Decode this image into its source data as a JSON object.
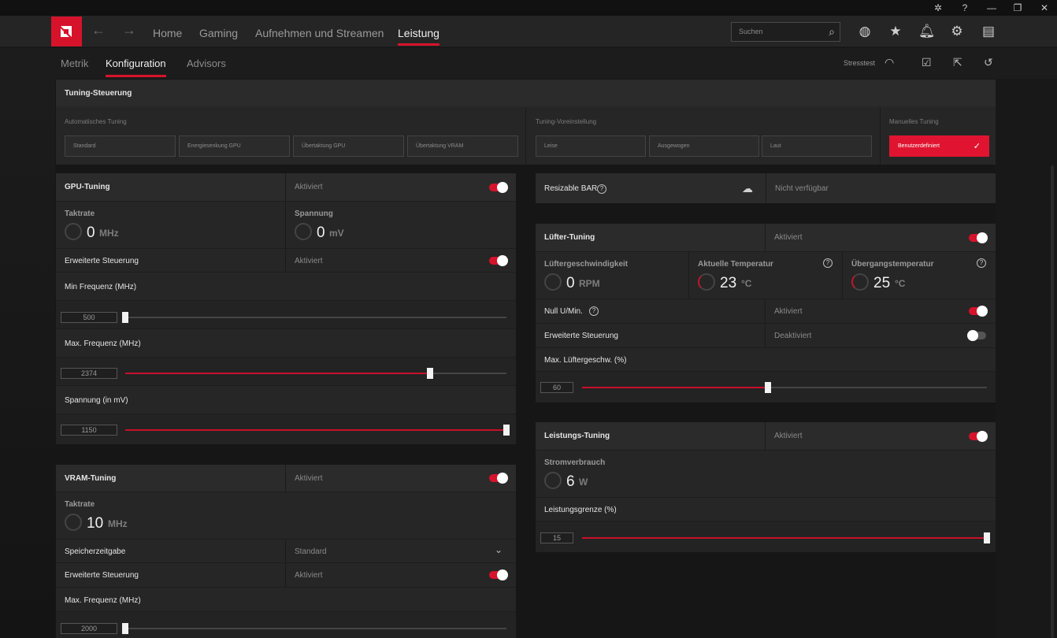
{
  "nav": {
    "items": [
      "Home",
      "Gaming",
      "Aufnehmen und Streamen",
      "Leistung"
    ],
    "search_placeholder": "Suchen"
  },
  "subnav": {
    "items": [
      "Metrik",
      "Konfiguration",
      "Advisors"
    ],
    "stresstest": "Stresstest"
  },
  "tuning": {
    "title": "Tuning-Steuerung",
    "auto_label": "Automatisches Tuning",
    "auto_buttons": [
      "Standard",
      "Energiesenkung GPU",
      "Übertaktung GPU",
      "Übertaktung VRAM"
    ],
    "preset_label": "Tuning-Voreinstellung",
    "preset_buttons": [
      "Leise",
      "Ausgewogen",
      "Laut"
    ],
    "manual_label": "Manuelles Tuning",
    "manual_button": "Benutzerdefiniert"
  },
  "gpu": {
    "title": "GPU-Tuning",
    "state": "Aktiviert",
    "clock_label": "Taktrate",
    "clock_value": "0",
    "clock_unit": "MHz",
    "voltage_label": "Spannung",
    "voltage_value": "0",
    "voltage_unit": "mV",
    "adv_label": "Erweiterte Steuerung",
    "adv_state": "Aktiviert",
    "min_freq_label": "Min Frequenz (MHz)",
    "min_freq_value": "500",
    "max_freq_label": "Max. Frequenz (MHz)",
    "max_freq_value": "2374",
    "volt_label": "Spannung (in mV)",
    "volt_value": "1150"
  },
  "vram": {
    "title": "VRAM-Tuning",
    "state": "Aktiviert",
    "clock_label": "Taktrate",
    "clock_value": "10",
    "clock_unit": "MHz",
    "timing_label": "Speicherzeitgabe",
    "timing_value": "Standard",
    "adv_label": "Erweiterte Steuerung",
    "adv_state": "Aktiviert",
    "max_freq_label": "Max. Frequenz (MHz)",
    "max_freq_value": "2000"
  },
  "bar": {
    "label": "Resizable BAR",
    "state": "Nicht verfügbar"
  },
  "fan": {
    "title": "Lüfter-Tuning",
    "state": "Aktiviert",
    "speed_label": "Lüftergeschwindigkeit",
    "speed_value": "0",
    "speed_unit": "RPM",
    "temp_label": "Aktuelle Temperatur",
    "temp_value": "23",
    "temp_unit": "°C",
    "junction_label": "Übergangstemperatur",
    "junction_value": "25",
    "junction_unit": "°C",
    "zero_label": "Null U/Min.",
    "zero_state": "Aktiviert",
    "adv_label": "Erweiterte Steuerung",
    "adv_state": "Deaktiviert",
    "max_label": "Max. Lüftergeschw. (%)",
    "max_value": "60"
  },
  "power": {
    "title": "Leistungs-Tuning",
    "state": "Aktiviert",
    "usage_label": "Stromverbrauch",
    "usage_value": "6",
    "usage_unit": "W",
    "limit_label": "Leistungsgrenze (%)",
    "limit_value": "15"
  },
  "sliders": {
    "gpu_min_fill": 0.0,
    "gpu_max_fill": 0.8,
    "gpu_volt_fill": 1.0,
    "vram_max_fill": 0.0,
    "fan_max_fill": 0.46,
    "power_limit_fill": 1.0
  },
  "colors": {
    "accent": "#d6132b"
  }
}
